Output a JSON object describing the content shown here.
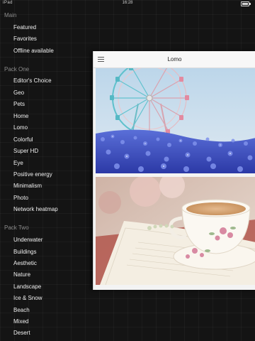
{
  "status_bar": {
    "carrier": "iPad",
    "time": "16:28"
  },
  "menu": {
    "sections": [
      {
        "header": "Main",
        "items": [
          "Featured",
          "Favorites",
          "Offline available"
        ]
      },
      {
        "header": "Pack One",
        "items": [
          "Editor's Choice",
          "Geo",
          "Pets",
          "Home",
          "Lomo",
          "Colorful",
          "Super HD",
          "Eye",
          "Positive energy",
          "Minimalism",
          "Photo",
          "Network heatmap"
        ]
      },
      {
        "header": "Pack Two",
        "items": [
          "Underwater",
          "Buildings",
          "Aesthetic",
          "Nature",
          "Landscape",
          "Ice & Snow",
          "Beach",
          "Mixed",
          "Desert"
        ]
      }
    ]
  },
  "panel": {
    "title": "Lomo",
    "menu_icon": "hamburger-menu-icon",
    "photos": [
      {
        "subject": "Ferris wheel over a field of blue flowers"
      },
      {
        "subject": "Teacup on an open book"
      }
    ]
  },
  "colors": {
    "background": "#141414",
    "menu_text": "#f0f0f0",
    "section_header": "#8c8c8c",
    "panel_background": "#f3f3f3"
  }
}
